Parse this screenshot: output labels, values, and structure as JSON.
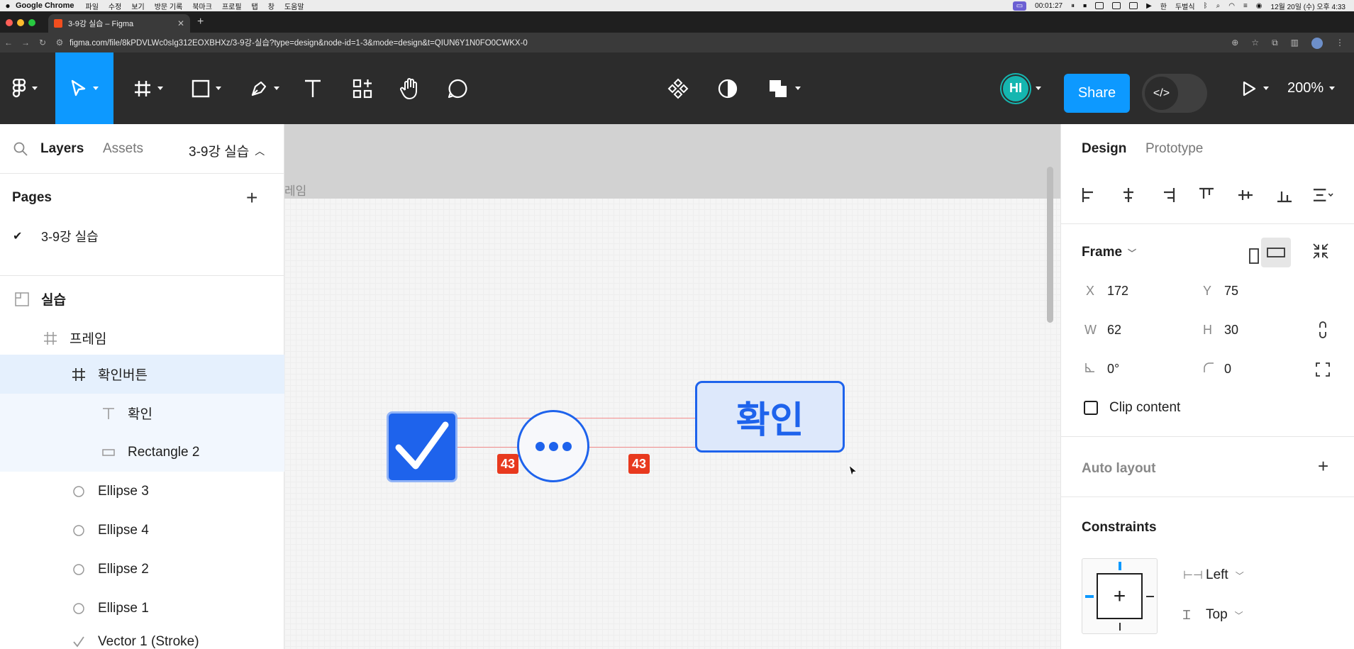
{
  "menubar": {
    "app": "Google Chrome",
    "items": [
      "파일",
      "수정",
      "보기",
      "방문 기록",
      "북마크",
      "프로필",
      "탭",
      "창",
      "도움말"
    ],
    "timer": "00:01:27",
    "input_method": "한",
    "input_method_label": "두벌식",
    "clock": "12월 20일 (수) 오후 4:33"
  },
  "browser": {
    "tab_title": "3-9강 실습 – Figma",
    "url": "figma.com/file/8kPDVLWc0sIg312EOXBHXz/3-9강-실습?type=design&node-id=1-3&mode=design&t=QIUN6Y1N0FO0CWKX-0"
  },
  "toolbar": {
    "avatar_initials": "HI",
    "share_label": "Share",
    "zoom": "200%"
  },
  "left_panel": {
    "tab_layers": "Layers",
    "tab_assets": "Assets",
    "current_page": "3-9강 실습",
    "pages_heading": "Pages",
    "pages": [
      {
        "name": "3-9강 실습"
      }
    ],
    "layers": [
      {
        "name": "실습",
        "icon": "section-icon"
      },
      {
        "name": "프레임",
        "icon": "frame-icon"
      },
      {
        "name": "확인버튼",
        "icon": "frame-icon"
      },
      {
        "name": "확인",
        "icon": "text-icon"
      },
      {
        "name": "Rectangle 2",
        "icon": "rectangle-icon"
      },
      {
        "name": "Ellipse 3",
        "icon": "ellipse-icon"
      },
      {
        "name": "Ellipse 4",
        "icon": "ellipse-icon"
      },
      {
        "name": "Ellipse 2",
        "icon": "ellipse-icon"
      },
      {
        "name": "Ellipse 1",
        "icon": "ellipse-icon"
      },
      {
        "name": "Vector 1 (Stroke)",
        "icon": "vector-icon"
      }
    ]
  },
  "canvas": {
    "frame_label": "레임",
    "button_text": "확인",
    "measure_left": "43",
    "measure_right": "43",
    "accent": "#1e63ec",
    "measure_color": "#e8391e"
  },
  "right_panel": {
    "tab_design": "Design",
    "tab_prototype": "Prototype",
    "frame_title": "Frame",
    "x_label": "X",
    "x_value": "172",
    "y_label": "Y",
    "y_value": "75",
    "w_label": "W",
    "w_value": "62",
    "h_label": "H",
    "h_value": "30",
    "rotation": "0°",
    "radius": "0",
    "clip_content": "Clip content",
    "auto_layout": "Auto layout",
    "constraints": "Constraints",
    "constraint_h": "Left",
    "constraint_v": "Top"
  }
}
